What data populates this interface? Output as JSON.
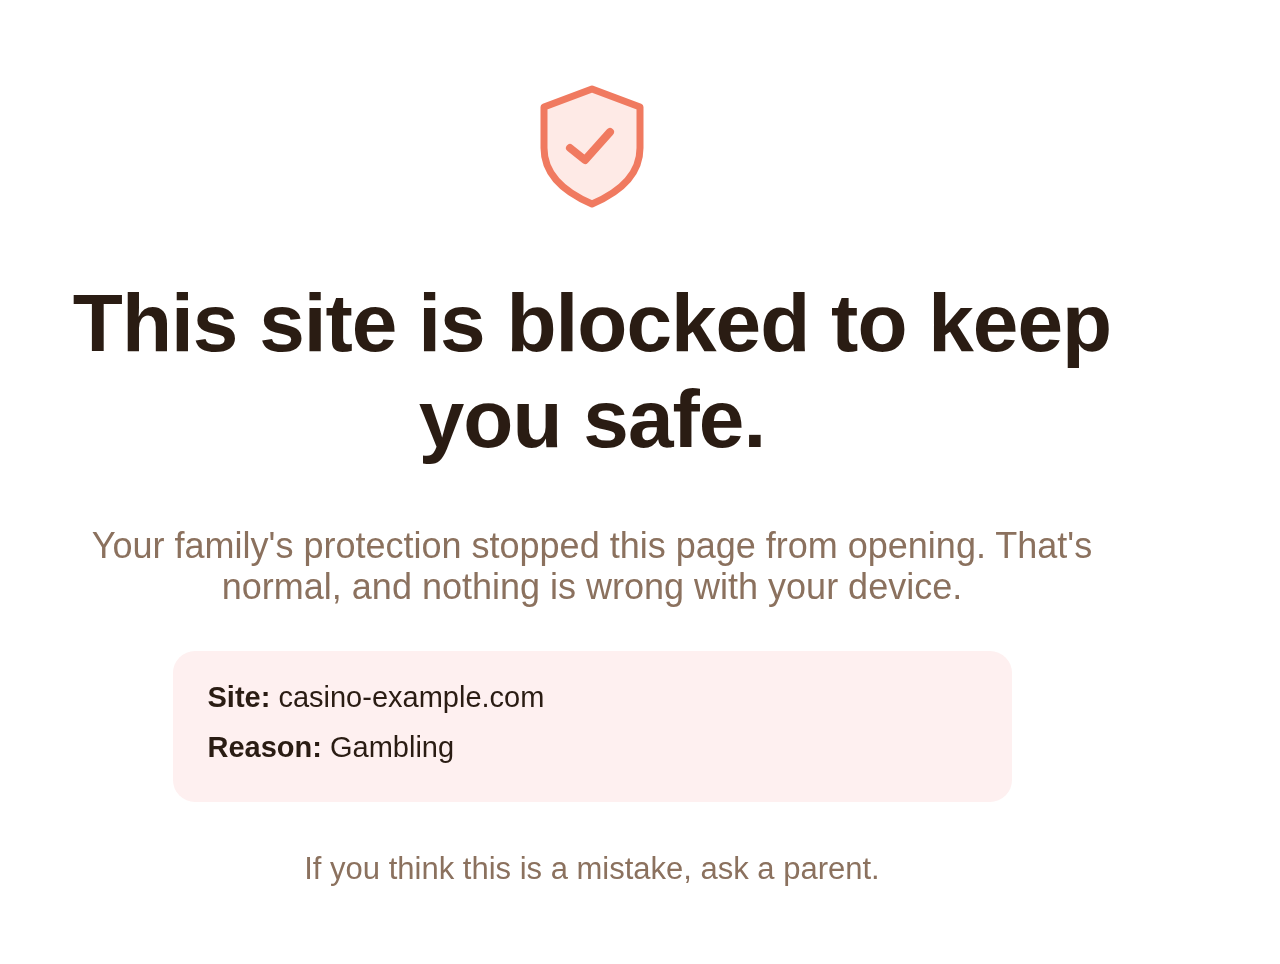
{
  "heading": "This site is blocked to keep you safe.",
  "message": "Your family's protection stopped this page from opening. That's normal, and nothing is wrong with your device.",
  "details": [
    {
      "label": "Site:",
      "value": "casino-example.com"
    },
    {
      "label": "Reason:",
      "value": "Gambling"
    }
  ],
  "footer_note": "If you think this is a mistake, ask a parent."
}
